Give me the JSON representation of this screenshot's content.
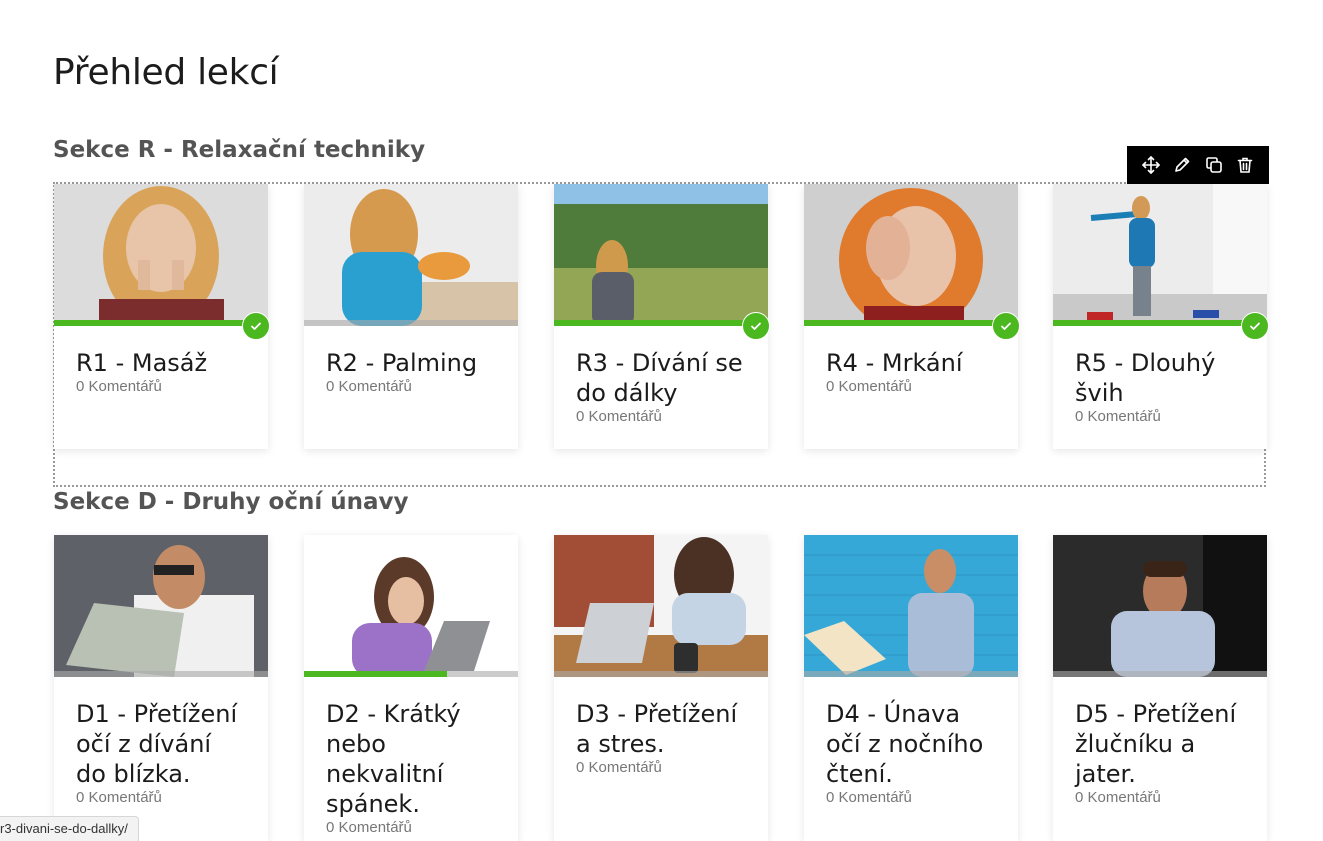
{
  "page": {
    "title": "Přehled lekcí"
  },
  "sections": [
    {
      "title": "Sekce R - Relaxační techniky",
      "cards": [
        {
          "title": "R1 - Masáž",
          "comments": "0 Komentářů",
          "progress": 1.0,
          "completed": true
        },
        {
          "title": "R2 - Palming",
          "comments": "0 Komentářů",
          "progress": 0,
          "completed": false
        },
        {
          "title": "R3 - Dívání se do dálky",
          "comments": "0 Komentářů",
          "progress": 1.0,
          "completed": true
        },
        {
          "title": "R4 - Mrkání",
          "comments": "0 Komentářů",
          "progress": 1.0,
          "completed": true
        },
        {
          "title": "R5 - Dlouhý švih",
          "comments": "0 Komentářů",
          "progress": 1.0,
          "completed": true
        }
      ]
    },
    {
      "title": "Sekce D - Druhy oční únavy",
      "cards": [
        {
          "title": "D1 - Přetížení očí z dívání do blízka.",
          "comments": "0 Komentářů",
          "progress": 0,
          "completed": false
        },
        {
          "title": "D2 - Krátký nebo nekvalitní spánek.",
          "comments": "0 Komentářů",
          "progress": 0.67,
          "completed": false
        },
        {
          "title": "D3 - Přetížení a stres.",
          "comments": "0 Komentářů",
          "progress": 0,
          "completed": false
        },
        {
          "title": "D4 - Únava očí z nočního čtení.",
          "comments": "0 Komentářů",
          "progress": 0,
          "completed": false
        },
        {
          "title": "D5 - Přetížení žlučníku a jater.",
          "comments": "0 Komentářů",
          "progress": 0,
          "completed": false
        }
      ]
    }
  ],
  "toolbar": {
    "icons": [
      "move-icon",
      "edit-icon",
      "duplicate-icon",
      "trash-icon"
    ]
  },
  "status_bar": {
    "url": "r3-divani-se-do-dallky/"
  },
  "colors": {
    "accent": "#4cb81f",
    "toolbar": "#000000"
  }
}
